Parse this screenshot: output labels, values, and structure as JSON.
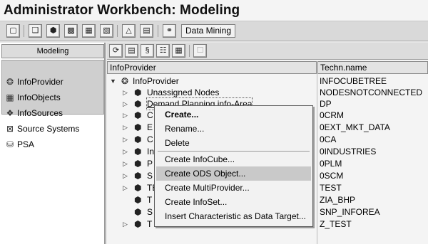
{
  "window": {
    "title": "Administrator Workbench: Modeling"
  },
  "app_toolbar": {
    "icons": [
      "screen-icon",
      "cube-group-icon",
      "cube-icon",
      "table-icon",
      "cube-grid-icon",
      "tree-icon",
      "document-icon",
      "chain-icon"
    ],
    "data_mining_label": "Data Mining"
  },
  "left_pane": {
    "header": "Modeling",
    "items": [
      {
        "label": "InfoProvider",
        "icon": "infoprovider-icon",
        "selected": true
      },
      {
        "label": "InfoObjects",
        "icon": "infoobjects-icon",
        "selected": false
      },
      {
        "label": "InfoSources",
        "icon": "infosources-icon",
        "selected": false
      },
      {
        "label": "Source Systems",
        "icon": "source-systems-icon",
        "selected": false
      },
      {
        "label": "PSA",
        "icon": "psa-icon",
        "selected": false
      }
    ]
  },
  "tree": {
    "columns": [
      "InfoProvider",
      "Techn.name"
    ],
    "root": {
      "label": "InfoProvider",
      "tech": "INFOCUBETREE"
    },
    "rows": [
      {
        "label": "Unassigned Nodes",
        "tech": "NODESNOTCONNECTED"
      },
      {
        "label": "Demand Planning info-Area",
        "tech": "DP"
      },
      {
        "label": "C",
        "tech": "0CRM"
      },
      {
        "label": "E",
        "tech": "0EXT_MKT_DATA"
      },
      {
        "label": "C",
        "tech": "0CA"
      },
      {
        "label": "In",
        "tech": "0INDUSTRIES"
      },
      {
        "label": "P",
        "tech": "0PLM"
      },
      {
        "label": "S",
        "tech": "0SCM"
      },
      {
        "label": "TE",
        "tech": "TEST"
      },
      {
        "label": "T",
        "tech": "ZIA_BHP"
      },
      {
        "label": "S",
        "tech": "SNP_INFOREA"
      },
      {
        "label": "T",
        "tech": "Z_TEST"
      }
    ]
  },
  "context_menu": {
    "items": [
      {
        "label": "Create...",
        "bold": true
      },
      {
        "label": "Rename..."
      },
      {
        "label": "Delete"
      },
      {
        "label": "Create InfoCube..."
      },
      {
        "label": "Create ODS Object...",
        "highlighted": true
      },
      {
        "label": "Create MultiProvider..."
      },
      {
        "label": "Create InfoSet..."
      },
      {
        "label": "Insert Characteristic as Data Target..."
      }
    ]
  }
}
